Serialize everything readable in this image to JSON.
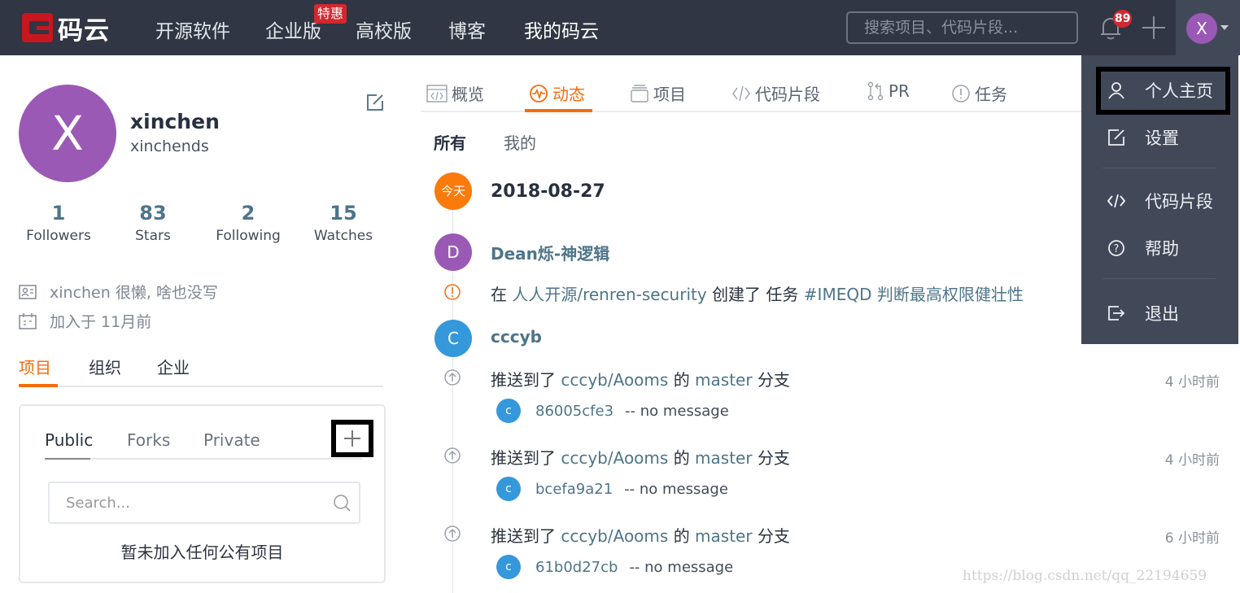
{
  "topnav": {
    "logo_text": "码云",
    "items": [
      {
        "label": "开源软件"
      },
      {
        "label": "企业版"
      },
      {
        "label": "高校版"
      },
      {
        "label": "博客"
      },
      {
        "label": "我的码云"
      }
    ],
    "promo_badge": "特惠",
    "search_placeholder": "搜索项目、代码片段...",
    "notification_count": "89",
    "user_initial": "X"
  },
  "dropdown": {
    "items": [
      {
        "label": "个人主页",
        "icon": "user-icon"
      },
      {
        "label": "设置",
        "icon": "edit-icon"
      },
      {
        "label": "代码片段",
        "icon": "code-icon"
      },
      {
        "label": "帮助",
        "icon": "help-icon"
      },
      {
        "label": "退出",
        "icon": "logout-icon"
      }
    ]
  },
  "profile": {
    "avatar_initial": "X",
    "name": "xinchen",
    "username": "xinchends",
    "stats": [
      {
        "value": "1",
        "label": "Followers"
      },
      {
        "value": "83",
        "label": "Stars"
      },
      {
        "value": "2",
        "label": "Following"
      },
      {
        "value": "15",
        "label": "Watches"
      }
    ],
    "bio": "xinchen 很懒, 啥也没写",
    "joined": "加入于 11月前",
    "tabs": [
      {
        "label": "项目"
      },
      {
        "label": "组织"
      },
      {
        "label": "企业"
      }
    ]
  },
  "projects": {
    "tabs": [
      {
        "label": "Public"
      },
      {
        "label": "Forks"
      },
      {
        "label": "Private"
      }
    ],
    "search_placeholder": "Search...",
    "empty_text": "暂未加入任何公有项目"
  },
  "main": {
    "tabs": [
      {
        "label": "概览"
      },
      {
        "label": "动态"
      },
      {
        "label": "项目"
      },
      {
        "label": "代码片段"
      },
      {
        "label": "PR"
      },
      {
        "label": "任务"
      }
    ],
    "subtabs": [
      {
        "label": "所有"
      },
      {
        "label": "我的"
      }
    ],
    "today_label": "今天",
    "date": "2018-08-27",
    "events": [
      {
        "actor": "Dean烁-神逻辑",
        "actor_initial": "D",
        "actor_color": "#9b59b6",
        "text_prefix": "在",
        "repo": "人人开源/renren-security",
        "action": "创建了 任务",
        "issue": "#IMEQD 判断最高权限健壮性"
      },
      {
        "actor": "cccyb",
        "actor_initial": "C",
        "actor_color": "#3498db",
        "pushes": [
          {
            "prefix": "推送到了",
            "repo": "cccyb/Aooms",
            "mid": "的",
            "branch": "master",
            "suffix": "分支",
            "time": "4 小时前",
            "commit_initial": "c",
            "hash": "86005cfe3",
            "message": "-- no message"
          },
          {
            "prefix": "推送到了",
            "repo": "cccyb/Aooms",
            "mid": "的",
            "branch": "master",
            "suffix": "分支",
            "time": "4 小时前",
            "commit_initial": "c",
            "hash": "bcefa9a21",
            "message": "-- no message"
          },
          {
            "prefix": "推送到了",
            "repo": "cccyb/Aooms",
            "mid": "的",
            "branch": "master",
            "suffix": "分支",
            "time": "6 小时前",
            "commit_initial": "c",
            "hash": "61b0d27cb",
            "message": "-- no message"
          }
        ]
      }
    ]
  },
  "watermark": "https://blog.csdn.net/qq_22194659",
  "colors": {
    "accent": "#f56c0b",
    "nav_bg": "#303643",
    "dropdown_bg": "#414959",
    "link": "#4e7589"
  }
}
